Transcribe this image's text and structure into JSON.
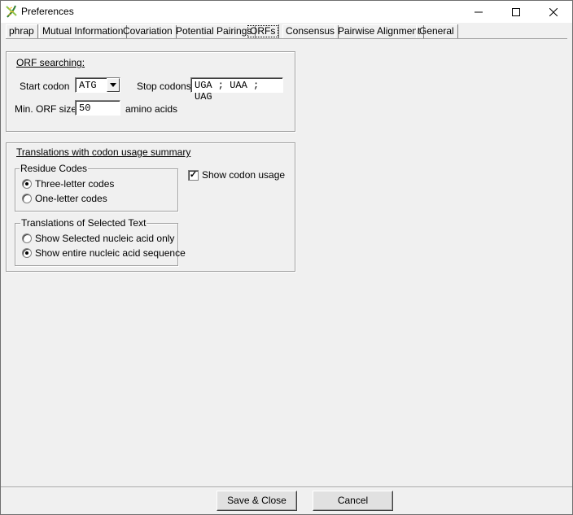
{
  "window": {
    "title": "Preferences",
    "minimize_glyph": "—",
    "maximize_glyph": "☐",
    "close_glyph": "✕"
  },
  "tabs": [
    {
      "label": "phrap",
      "active": false
    },
    {
      "label": "Mutual Information",
      "active": false
    },
    {
      "label": "Covariation",
      "active": false
    },
    {
      "label": "Potential Pairings",
      "active": false
    },
    {
      "label": "ORFs",
      "active": true
    },
    {
      "label": "Consensus",
      "active": false
    },
    {
      "label": "Pairwise Alignment",
      "active": false
    },
    {
      "label": "General",
      "active": false
    }
  ],
  "orf_searching": {
    "heading": "ORF searching:",
    "start_codon_label": "Start codon",
    "start_codon_value": "ATG",
    "stop_codons_label": "Stop codons",
    "stop_codons_value": "UGA ; UAA ; UAG",
    "min_orf_label": "Min. ORF size",
    "min_orf_value": "50",
    "min_orf_unit": "amino acids"
  },
  "translations": {
    "heading": "Translations with codon usage summary",
    "residue_codes": {
      "title": "Residue Codes",
      "options": [
        {
          "label": "Three-letter codes",
          "selected": true
        },
        {
          "label": "One-letter codes",
          "selected": false
        }
      ]
    },
    "show_codon_usage": {
      "label": "Show codon usage",
      "checked": true,
      "check_glyph": "✓"
    },
    "selected_text": {
      "title": "Translations of Selected Text",
      "options": [
        {
          "label": "Show Selected nucleic acid only",
          "selected": false
        },
        {
          "label": "Show entire nucleic acid sequence",
          "selected": true
        }
      ]
    }
  },
  "footer": {
    "save_label": "Save & Close",
    "cancel_label": "Cancel"
  },
  "icons": {
    "app": "dna-helix-icon",
    "combo_arrow": "triangle-down-icon"
  },
  "colors": {
    "window_bg": "#f0f0f0",
    "title_bg": "#ffffff",
    "border": "#a0a0a0"
  }
}
